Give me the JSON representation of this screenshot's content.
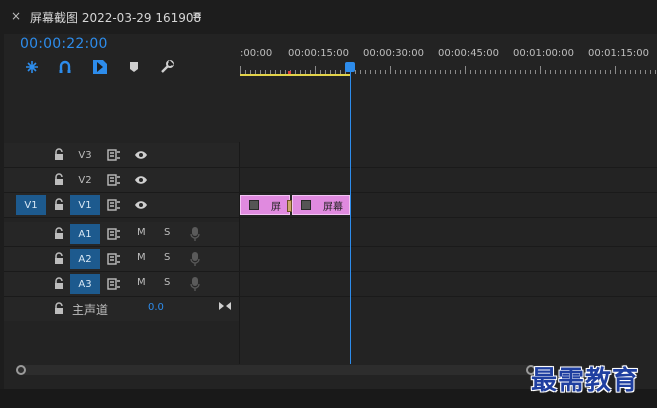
{
  "tab": {
    "close_glyph": "×",
    "title": "屏幕截图 2022-03-29 161908",
    "menu_glyph": "≡"
  },
  "timecode": "00:00:22:00",
  "tools": [
    "snap-in-sequence-icon",
    "linked-selection-icon",
    "add-marker-icon",
    "marker-icon",
    "wrench-icon"
  ],
  "ruler": {
    "labels": [
      ":00:00",
      "00:00:15:00",
      "00:00:30:00",
      "00:00:45:00",
      "00:01:00:00",
      "00:01:15:00"
    ]
  },
  "tracks": {
    "v3": {
      "name": "V3"
    },
    "v2": {
      "name": "V2"
    },
    "v1": {
      "source": "V1",
      "name": "V1"
    },
    "a1": {
      "name": "A1",
      "mute": "M",
      "solo": "S"
    },
    "a2": {
      "name": "A2",
      "mute": "M",
      "solo": "S"
    },
    "a3": {
      "name": "A3",
      "mute": "M",
      "solo": "S"
    },
    "master": {
      "label": "主声道",
      "value": "0.0"
    }
  },
  "clips": [
    {
      "text": "屏"
    },
    {
      "text": "屏幕"
    }
  ],
  "colors": {
    "accent": "#2d8ceb",
    "clip": "#e08adf",
    "work_area": "#e3d44a"
  },
  "watermark": "最需教育"
}
